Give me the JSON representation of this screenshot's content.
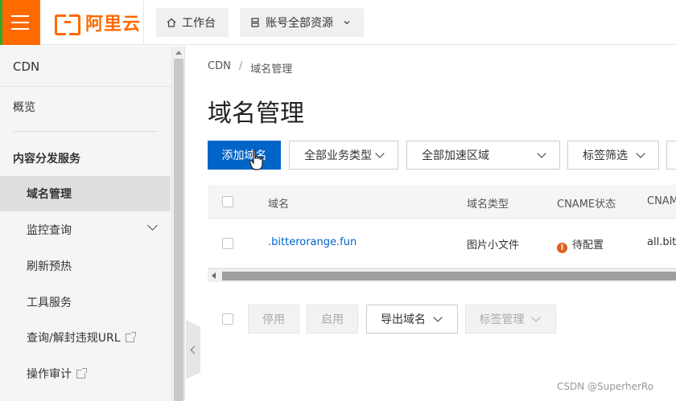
{
  "header": {
    "logo_text": "阿里云",
    "workbench_label": "工作台",
    "resources_label": "账号全部资源",
    "brand_color": "#ff6a00"
  },
  "sidebar": {
    "title": "CDN",
    "items": [
      {
        "label": "概览"
      },
      {
        "label": "内容分发服务"
      },
      {
        "label": "域名管理"
      },
      {
        "label": "监控查询"
      },
      {
        "label": "刷新预热"
      },
      {
        "label": "工具服务"
      },
      {
        "label": "查询/解封违规URL"
      },
      {
        "label": "操作审计"
      }
    ]
  },
  "breadcrumb": {
    "root": "CDN",
    "separator": "/",
    "current": "域名管理"
  },
  "page": {
    "title": "域名管理"
  },
  "toolbar": {
    "add_label": "添加域名",
    "business_type": "全部业务类型",
    "region": "全部加速区域",
    "tag_filter": "标签筛选",
    "primary_color": "#0064c8"
  },
  "table": {
    "columns": [
      "域名",
      "域名类型",
      "CNAME状态",
      "CNAM"
    ],
    "rows": [
      {
        "domain": ".bitterorange.fun",
        "type": "图片小文件",
        "cname_status": "待配置",
        "cname": "all.bitt"
      }
    ]
  },
  "bulk_actions": {
    "disable": "停用",
    "enable": "启用",
    "export": "导出域名",
    "tag_manage": "标签管理"
  },
  "watermark": "CSDN @SuperherRo"
}
